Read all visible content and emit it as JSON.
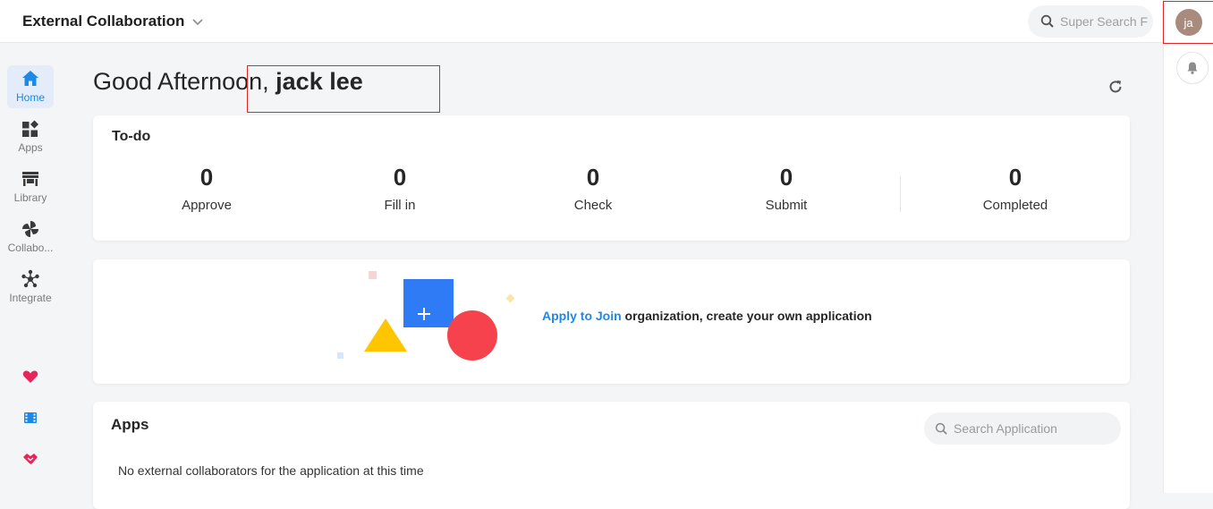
{
  "header": {
    "org_title": "External Collaboration",
    "super_search_placeholder": "Super Search  F"
  },
  "user": {
    "avatar_initials": "ja"
  },
  "sidebar": {
    "items": [
      {
        "label": "Home",
        "icon": "home-icon",
        "active": true
      },
      {
        "label": "Apps",
        "icon": "apps-icon",
        "active": false
      },
      {
        "label": "Library",
        "icon": "library-icon",
        "active": false
      },
      {
        "label": "Collabo...",
        "icon": "collaboration-icon",
        "active": false
      },
      {
        "label": "Integrate",
        "icon": "integrate-icon",
        "active": false
      }
    ],
    "shortcuts": [
      "heart-icon",
      "film-icon",
      "handshake-icon"
    ]
  },
  "greeting": {
    "prefix": "Good Afternoon, ",
    "name": "jack lee"
  },
  "todo": {
    "title": "To-do",
    "stats": [
      {
        "value": "0",
        "label": "Approve"
      },
      {
        "value": "0",
        "label": "Fill in"
      },
      {
        "value": "0",
        "label": "Check"
      },
      {
        "value": "0",
        "label": "Submit"
      },
      {
        "value": "0",
        "label": "Completed"
      }
    ]
  },
  "join_banner": {
    "link_text": "Apply to Join",
    "rest_text": " organization, create your own application"
  },
  "apps": {
    "title": "Apps",
    "search_placeholder": "Search Application",
    "empty_text": "No external collaborators for the application at this time"
  },
  "colors": {
    "accent": "#1e88e5",
    "highlight": "#e0262b",
    "illus_blue": "#2f7bf5",
    "illus_red": "#f5424d",
    "illus_yellow": "#ffc600"
  }
}
